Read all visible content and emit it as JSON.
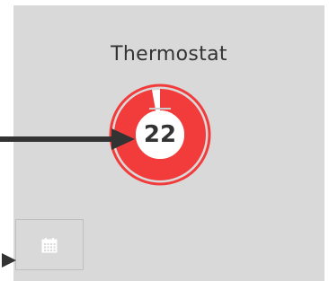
{
  "widget": {
    "title": "Thermostat",
    "value": "22",
    "gauge_fraction": 0.97,
    "colors": {
      "accent": "#f23c3c",
      "panel": "#d9d9d9",
      "text": "#333333",
      "arrow": "#333333"
    }
  },
  "calendar_button": {
    "icon": "calendar-icon"
  },
  "annotations": {
    "arrows": [
      "arrow-to-gauge-value",
      "arrow-to-calendar-button"
    ]
  }
}
